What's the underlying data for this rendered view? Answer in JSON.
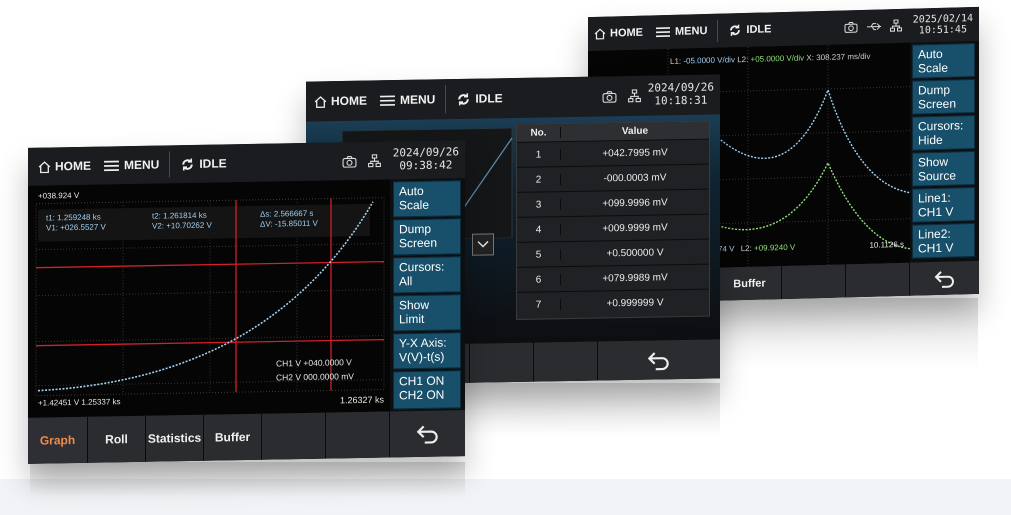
{
  "back_screen": {
    "topbar": {
      "home_label": "HOME",
      "menu_label": "MENU",
      "status_label": "IDLE",
      "date": "2025/02/14",
      "time": "10:51:45"
    },
    "readout": {
      "l1_label": "L1:",
      "l1_value": "-05.0000 V/div",
      "l2_label": "L2:",
      "l2_value": "+05.0000 V/div",
      "x_label": "X:",
      "x_value": "308.237 ms/div"
    },
    "bottom_readout": {
      "left": "74 V",
      "l2_label": "L2:",
      "l2_value": "+09.9240 V",
      "time_value": "10.1126 s"
    },
    "side_buttons": [
      {
        "line1": "Auto",
        "line2": "Scale"
      },
      {
        "line1": "Dump",
        "line2": "Screen"
      },
      {
        "line1": "Cursors:",
        "line2": "Hide"
      },
      {
        "line1": "Show",
        "line2": "Source"
      },
      {
        "line1": "Line1:",
        "line2": "CH1 V"
      },
      {
        "line1": "Line2:",
        "line2": "CH1 V"
      }
    ],
    "tabs": [
      "ics",
      "Buffer",
      "",
      ""
    ]
  },
  "middle_screen": {
    "topbar": {
      "home_label": "HOME",
      "menu_label": "MENU",
      "status_label": "IDLE",
      "date": "2024/09/26",
      "time": "10:18:31"
    },
    "table": {
      "headers": [
        "No.",
        "Value"
      ],
      "rows": [
        {
          "no": "1",
          "value": "+042.7995 mV"
        },
        {
          "no": "2",
          "value": "-000.0003 mV"
        },
        {
          "no": "3",
          "value": "+099.9996 mV"
        },
        {
          "no": "4",
          "value": "+009.9999 mV"
        },
        {
          "no": "5",
          "value": "+0.500000 V"
        },
        {
          "no": "6",
          "value": "+079.9989 mV"
        },
        {
          "no": "7",
          "value": "+0.999999 V"
        }
      ]
    }
  },
  "front_screen": {
    "topbar": {
      "home_label": "HOME",
      "menu_label": "MENU",
      "status_label": "IDLE",
      "date": "2024/09/26",
      "time": "09:38:42"
    },
    "plot": {
      "y_top": "+038.924 V",
      "t1_label": "t1:",
      "t1_value": "1.259248 ks",
      "v1_label": "V1:",
      "v1_value": "+026.5527 V",
      "t2_label": "t2:",
      "t2_value": "1.261814 ks",
      "v2_label": "V2:",
      "v2_value": "+10.70262 V",
      "ds_label": "Δs:",
      "ds_value": "2.566667  s",
      "dv_label": "ΔV:",
      "dv_value": "-15.85011 V",
      "ch1_line": "CH1 V +040.0000 V",
      "ch2_line": "CH2 V 000.0000 mV",
      "y_bottom": "+1.42451 V",
      "x_left": "1.25337 ks",
      "x_right": "1.26327 ks"
    },
    "side_buttons": [
      {
        "line1": "Auto",
        "line2": "Scale"
      },
      {
        "line1": "Dump",
        "line2": "Screen"
      },
      {
        "line1": "Cursors:",
        "line2": "All"
      },
      {
        "line1": "Show",
        "line2": "Limit"
      },
      {
        "line1": "Y-X Axis:",
        "line2": "V(V)-t(s)"
      },
      {
        "line1": "CH1 ON",
        "line2": "CH2 ON"
      }
    ],
    "tabs": [
      "Graph",
      "Roll",
      "Statistics",
      "Buffer",
      "",
      ""
    ],
    "colors": {
      "accent_tab": "#f08a4b",
      "side_button": "#18506b",
      "cursor_line": "#d0202a",
      "trace_blue": "#9fd0f2",
      "trace_green": "#8fe07a"
    }
  }
}
